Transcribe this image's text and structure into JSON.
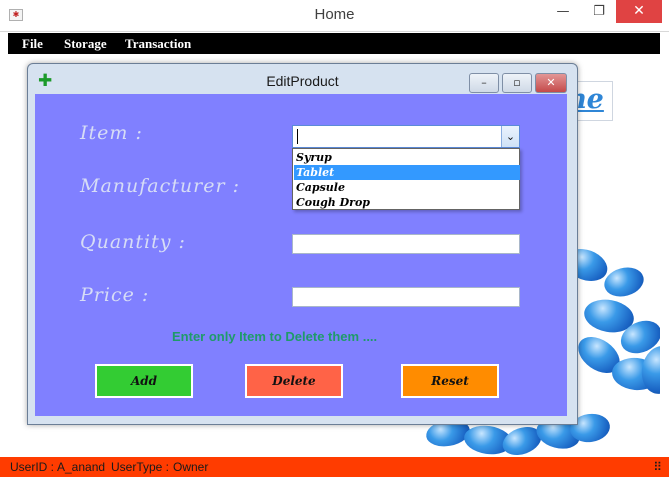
{
  "window": {
    "title": "Home",
    "minimize_glyph": "—",
    "maximize_glyph": "❐",
    "close_glyph": "✕",
    "close_color": "#e04343"
  },
  "menu": [
    "File",
    "Storage",
    "Transaction"
  ],
  "welcome": "Welcome !",
  "dialog": {
    "title": "EditProduct",
    "icon": "plus-icon",
    "labels": {
      "item": "Item :",
      "manufacturer": "Manufacturer :",
      "quantity": "Quantity :",
      "price": "Price :"
    },
    "item_value": "",
    "item_options": [
      "Syrup",
      "Tablet",
      "Capsule",
      "Cough Drop"
    ],
    "highlighted_option": "Tablet",
    "quantity_value": "",
    "price_value": "",
    "hint": "Enter only Item to Delete them ....",
    "buttons": {
      "add": "Add",
      "delete": "Delete",
      "reset": "Reset"
    },
    "colors": {
      "panel": "#8080ff",
      "add": "#33cc33",
      "delete": "#ff6347",
      "reset": "#ff8c00",
      "hint": "#1f9a6a"
    }
  },
  "status": {
    "user_id_label": "UserID :",
    "user_id": "A_anand",
    "user_type_label": "UserType :",
    "user_type": "Owner",
    "bar_color": "#ff3c00"
  }
}
